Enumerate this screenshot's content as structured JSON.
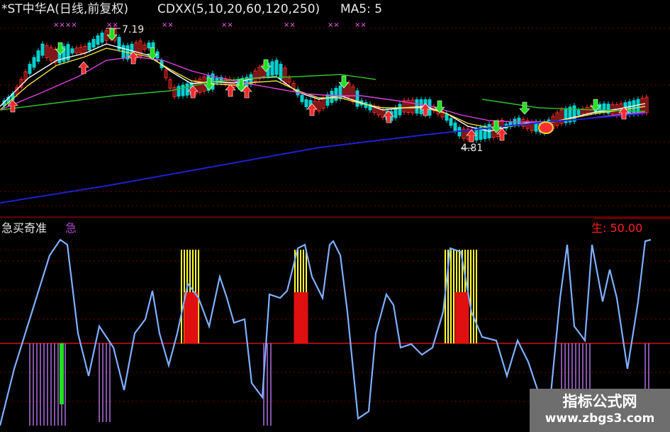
{
  "header": {
    "title": "*ST中华A(日线,前复权)",
    "params": "CDXX(5,10,20,60,120,250)",
    "ma5": "MA5: 5"
  },
  "annotations": {
    "high_price": "7.19",
    "low_price": "4.81"
  },
  "indicator": {
    "name": "急买奇准",
    "tag": "急",
    "value": "生: 50.00"
  },
  "watermark": {
    "line1": "指标公式网",
    "line2": "www.zbgs3.com"
  },
  "colors": {
    "background": "#000000",
    "up_candle": "#ff2b2b",
    "down_candle": "#00d0d0",
    "ma5": "#ffffff",
    "ma10": "#f0e040",
    "ma20": "#e040e0",
    "ma60": "#30c030",
    "ma250": "#2020d0",
    "oscillator": "#7fb0ff",
    "bar_yellow": "#ffff30",
    "bar_red": "#e01010",
    "bar_purple": "#b070e0",
    "bar_green": "#20e020",
    "baseline": "#d01010"
  },
  "icons": [
    "buy-arrow-icon",
    "sell-arrow-icon",
    "signal-marker-icon"
  ]
}
